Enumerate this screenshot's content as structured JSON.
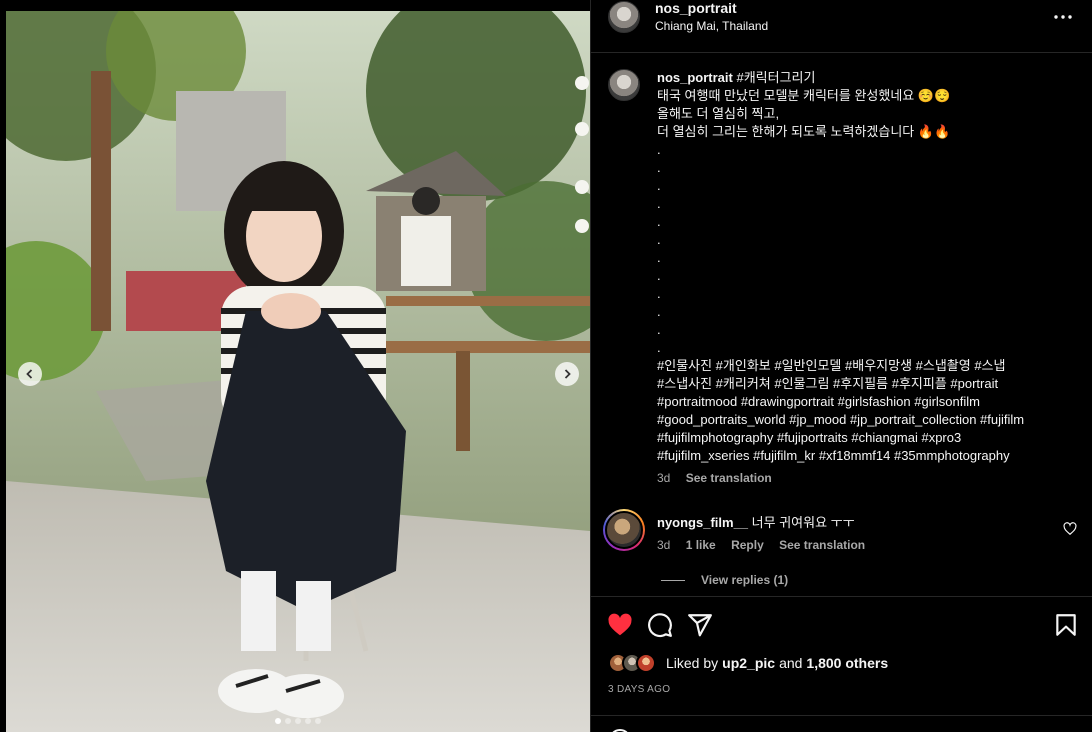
{
  "post": {
    "username": "nos_portrait",
    "location": "Chiang Mai, Thailand",
    "carousel": {
      "slide_count": 5,
      "active_index": 0
    }
  },
  "caption": {
    "username": "nos_portrait",
    "first_tag": "#캐릭터그리기",
    "lines": [
      "태국 여행때 만났던 모델분 캐릭터를 완성했네요 ☺️😌",
      "올해도 더 열심히 찍고,",
      "더 열심히 그리는 한해가 되도록 노력하겠습니다 🔥🔥"
    ],
    "dots": [
      ".",
      ".",
      ".",
      ".",
      ".",
      ".",
      ".",
      ".",
      ".",
      ".",
      ".",
      "."
    ],
    "hashtag_lines": [
      "#인물사진 #개인화보 #일반인모델 #배우지망생 #스냅촬영 #스냅",
      "#스냅사진 #캐리커쳐 #인물그림 #후지필름 #후지피플 #portrait",
      "#portraitmood #drawingportrait #girlsfashion #girlsonfilm",
      "#good_portraits_world #jp_mood #jp_portrait_collection #fujifilm",
      "#fujifilmphotography #fujiportraits #chiangmai #xpro3",
      "#fujifilm_xseries #fujifilm_kr #xf18mmf14 #35mmphotography"
    ],
    "time": "3d",
    "see_translation": "See translation"
  },
  "comment": {
    "username": "nyongs_film__",
    "text": "너무 귀여워요 ㅜㅜ",
    "time": "3d",
    "likes": "1 like",
    "reply": "Reply",
    "see_translation": "See translation",
    "view_replies": "View replies (1)"
  },
  "actions": {
    "liked": true,
    "like_color": "#ff3040",
    "liked_by_prefix": "Liked by",
    "liked_by_user": "up2_pic",
    "and": "and",
    "others": "1,800 others",
    "date": "3 DAYS AGO"
  },
  "icons": [
    "more-icon",
    "chevron-left-icon",
    "chevron-right-icon",
    "heart-icon",
    "comment-icon",
    "share-icon",
    "bookmark-icon",
    "emoji-icon"
  ]
}
